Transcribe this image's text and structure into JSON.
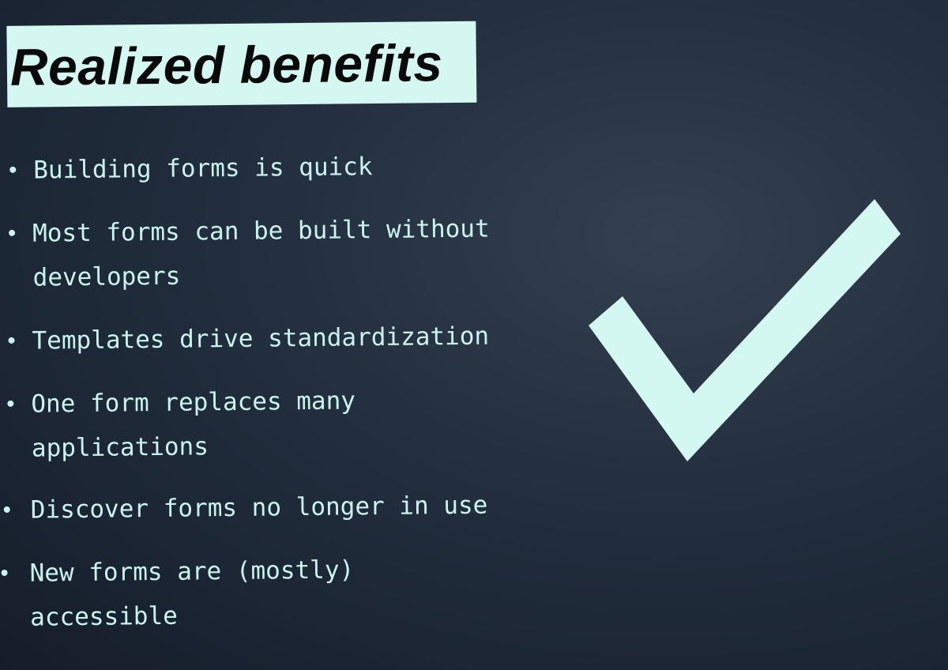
{
  "slide": {
    "title": "Realized benefits",
    "bullets": [
      {
        "lines": [
          "Building forms is quick"
        ]
      },
      {
        "lines": [
          "Most forms can be built without",
          "developers"
        ]
      },
      {
        "lines": [
          "Templates drive standardization"
        ]
      },
      {
        "lines": [
          "One form replaces many",
          "applications"
        ]
      },
      {
        "lines": [
          "Discover forms no longer in use"
        ]
      },
      {
        "lines": [
          "New forms are (mostly)",
          "accessible"
        ]
      }
    ],
    "check_icon": "checkmark-icon"
  },
  "colors": {
    "background": "#1f2a38",
    "title_background": "#d5f7f1",
    "title_text": "#0a0a0a",
    "bullet_text": "#c9f4ee",
    "checkmark": "#d3f8f1"
  }
}
